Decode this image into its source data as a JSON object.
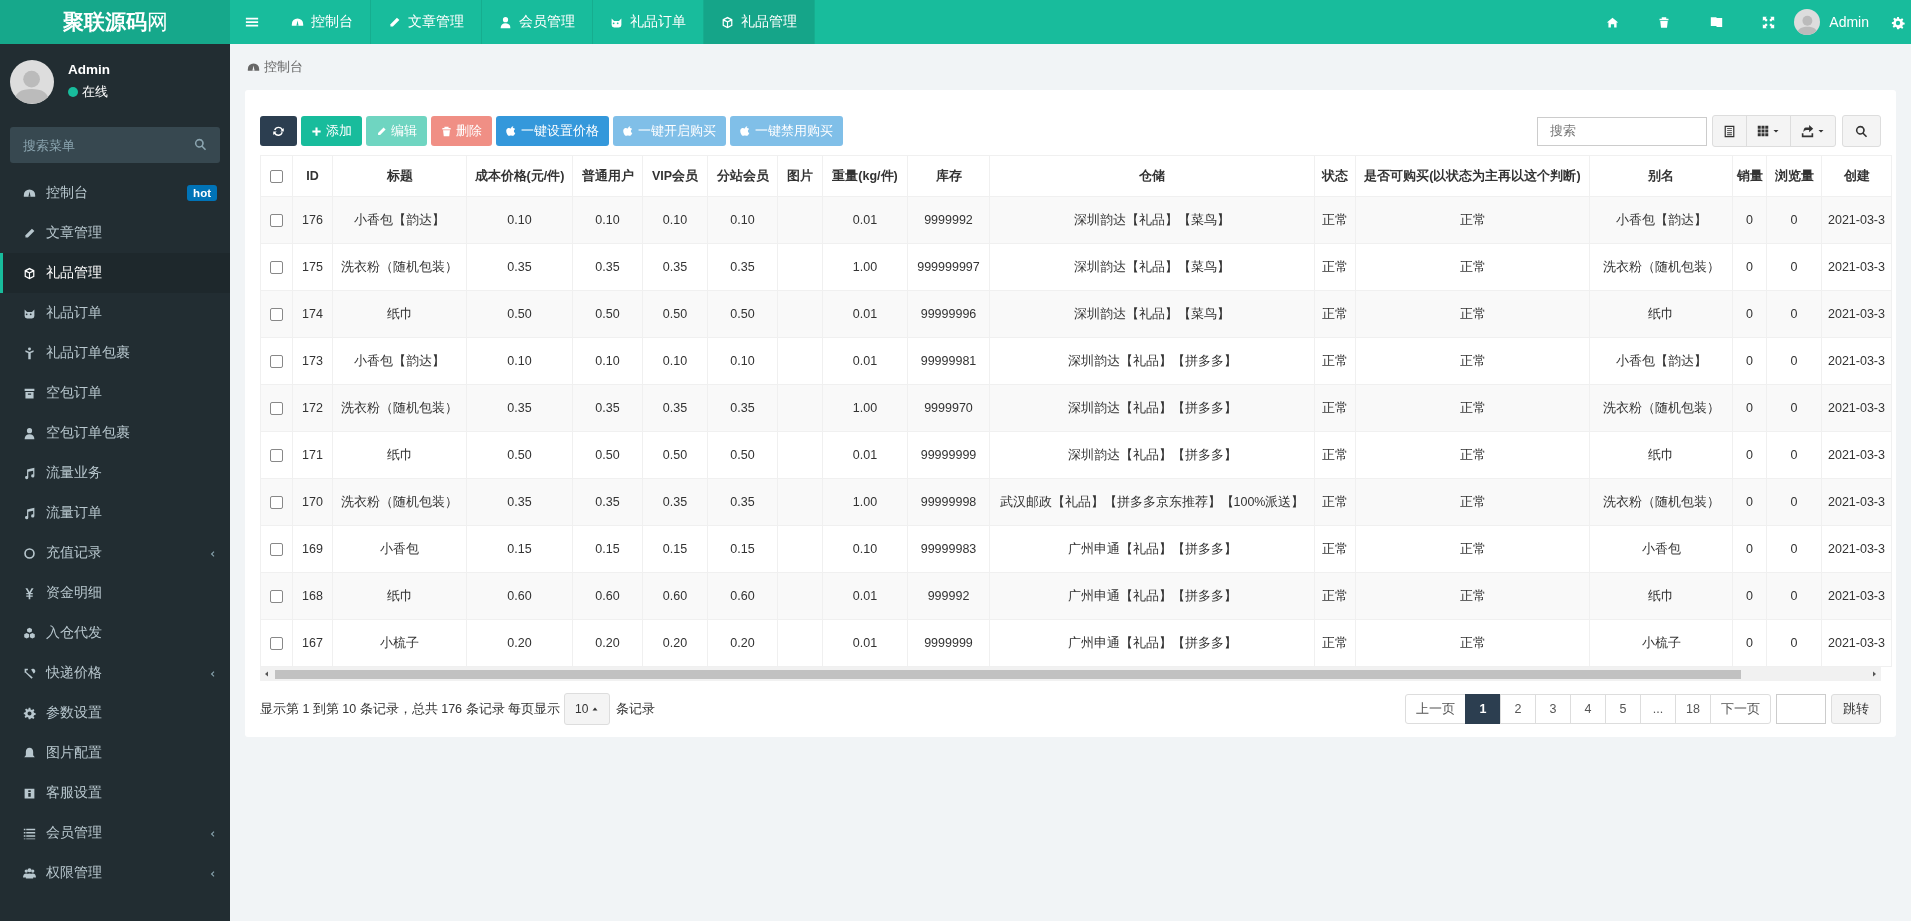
{
  "brand": {
    "name": "聚联源码",
    "suffix": "网"
  },
  "top_nav": {
    "tabs": [
      {
        "label": "控制台",
        "selected": false
      },
      {
        "label": "文章管理",
        "selected": false
      },
      {
        "label": "会员管理",
        "selected": false
      },
      {
        "label": "礼品订单",
        "selected": false
      },
      {
        "label": "礼品管理",
        "selected": true
      }
    ],
    "user": "Admin"
  },
  "sidebar": {
    "user": {
      "name": "Admin",
      "status": "在线",
      "online": true
    },
    "search": {
      "placeholder": "搜索菜单"
    },
    "items": [
      {
        "label": "控制台",
        "selected": false,
        "badge": "hot",
        "expandable": false
      },
      {
        "label": "文章管理",
        "selected": false,
        "expandable": false
      },
      {
        "label": "礼品管理",
        "selected": true,
        "expandable": false
      },
      {
        "label": "礼品订单",
        "selected": false,
        "expandable": false
      },
      {
        "label": "礼品订单包裹",
        "selected": false,
        "expandable": false
      },
      {
        "label": "空包订单",
        "selected": false,
        "expandable": false
      },
      {
        "label": "空包订单包裹",
        "selected": false,
        "expandable": false
      },
      {
        "label": "流量业务",
        "selected": false,
        "expandable": false
      },
      {
        "label": "流量订单",
        "selected": false,
        "expandable": false
      },
      {
        "label": "充值记录",
        "selected": false,
        "expandable": true
      },
      {
        "label": "资金明细",
        "selected": false,
        "expandable": false
      },
      {
        "label": "入仓代发",
        "selected": false,
        "expandable": false
      },
      {
        "label": "快递价格",
        "selected": false,
        "expandable": true
      },
      {
        "label": "参数设置",
        "selected": false,
        "expandable": false
      },
      {
        "label": "图片配置",
        "selected": false,
        "expandable": false
      },
      {
        "label": "客服设置",
        "selected": false,
        "expandable": false
      },
      {
        "label": "会员管理",
        "selected": false,
        "expandable": true
      },
      {
        "label": "权限管理",
        "selected": false,
        "expandable": true
      }
    ]
  },
  "breadcrumb": "控制台",
  "toolbar": {
    "buttons": [
      {
        "kind": "refresh",
        "disabled": false
      },
      {
        "label": "添加",
        "kind": "add",
        "disabled": false
      },
      {
        "label": "编辑",
        "kind": "edit",
        "disabled": true
      },
      {
        "label": "删除",
        "kind": "delete",
        "disabled": true
      },
      {
        "label": "一键设置价格",
        "kind": "apple",
        "disabled": false
      },
      {
        "label": "一键开启购买",
        "kind": "apple",
        "disabled": true
      },
      {
        "label": "一键禁用购买",
        "kind": "apple",
        "disabled": true
      }
    ],
    "search": {
      "placeholder": "搜索"
    }
  },
  "table": {
    "select_all": {
      "checked": false
    },
    "columns": [
      "ID",
      "标题",
      "成本价格(元/件)",
      "普通用户",
      "VIP会员",
      "分站会员",
      "图片",
      "重量(kg/件)",
      "库存",
      "仓储",
      "状态",
      "是否可购买(以状态为主再以这个判断)",
      "别名",
      "销量",
      "浏览量",
      "创建"
    ],
    "rows": [
      {
        "checked": false,
        "cells": [
          "176",
          "小香包【韵达】",
          "0.10",
          "0.10",
          "0.10",
          "0.10",
          "",
          "0.01",
          "9999992",
          "深圳韵达【礼品】【菜鸟】",
          "正常",
          "正常",
          "小香包【韵达】",
          "0",
          "0",
          "2021-03-3"
        ]
      },
      {
        "checked": false,
        "cells": [
          "175",
          "洗衣粉（随机包装）",
          "0.35",
          "0.35",
          "0.35",
          "0.35",
          "",
          "1.00",
          "999999997",
          "深圳韵达【礼品】【菜鸟】",
          "正常",
          "正常",
          "洗衣粉（随机包装）",
          "0",
          "0",
          "2021-03-3"
        ]
      },
      {
        "checked": false,
        "cells": [
          "174",
          "纸巾",
          "0.50",
          "0.50",
          "0.50",
          "0.50",
          "",
          "0.01",
          "99999996",
          "深圳韵达【礼品】【菜鸟】",
          "正常",
          "正常",
          "纸巾",
          "0",
          "0",
          "2021-03-3"
        ]
      },
      {
        "checked": false,
        "cells": [
          "173",
          "小香包【韵达】",
          "0.10",
          "0.10",
          "0.10",
          "0.10",
          "",
          "0.01",
          "99999981",
          "深圳韵达【礼品】【拼多多】",
          "正常",
          "正常",
          "小香包【韵达】",
          "0",
          "0",
          "2021-03-3"
        ]
      },
      {
        "checked": false,
        "cells": [
          "172",
          "洗衣粉（随机包装）",
          "0.35",
          "0.35",
          "0.35",
          "0.35",
          "",
          "1.00",
          "9999970",
          "深圳韵达【礼品】【拼多多】",
          "正常",
          "正常",
          "洗衣粉（随机包装）",
          "0",
          "0",
          "2021-03-3"
        ]
      },
      {
        "checked": false,
        "cells": [
          "171",
          "纸巾",
          "0.50",
          "0.50",
          "0.50",
          "0.50",
          "",
          "0.01",
          "99999999",
          "深圳韵达【礼品】【拼多多】",
          "正常",
          "正常",
          "纸巾",
          "0",
          "0",
          "2021-03-3"
        ]
      },
      {
        "checked": false,
        "cells": [
          "170",
          "洗衣粉（随机包装）",
          "0.35",
          "0.35",
          "0.35",
          "0.35",
          "",
          "1.00",
          "99999998",
          "武汉邮政【礼品】【拼多多京东推荐】【100%派送】",
          "正常",
          "正常",
          "洗衣粉（随机包装）",
          "0",
          "0",
          "2021-03-3"
        ]
      },
      {
        "checked": false,
        "cells": [
          "169",
          "小香包",
          "0.15",
          "0.15",
          "0.15",
          "0.15",
          "",
          "0.10",
          "99999983",
          "广州申通【礼品】【拼多多】",
          "正常",
          "正常",
          "小香包",
          "0",
          "0",
          "2021-03-3"
        ]
      },
      {
        "checked": false,
        "cells": [
          "168",
          "纸巾",
          "0.60",
          "0.60",
          "0.60",
          "0.60",
          "",
          "0.01",
          "999992",
          "广州申通【礼品】【拼多多】",
          "正常",
          "正常",
          "纸巾",
          "0",
          "0",
          "2021-03-3"
        ]
      },
      {
        "checked": false,
        "cells": [
          "167",
          "小梳子",
          "0.20",
          "0.20",
          "0.20",
          "0.20",
          "",
          "0.01",
          "9999999",
          "广州申通【礼品】【拼多多】",
          "正常",
          "正常",
          "小梳子",
          "0",
          "0",
          "2021-03-3"
        ]
      }
    ]
  },
  "pagination": {
    "summary": "显示第 1 到第 10 条记录，总共 176 条记录 每页显示",
    "page_size": "10",
    "summary_after": "条记录",
    "prev": "上一页",
    "pages": [
      {
        "label": "1",
        "selected": true
      },
      {
        "label": "2",
        "selected": false
      },
      {
        "label": "3",
        "selected": false
      },
      {
        "label": "4",
        "selected": false
      },
      {
        "label": "5",
        "selected": false
      },
      {
        "label": "...",
        "selected": false
      },
      {
        "label": "18",
        "selected": false
      }
    ],
    "next": "下一页",
    "jump": "跳转"
  }
}
